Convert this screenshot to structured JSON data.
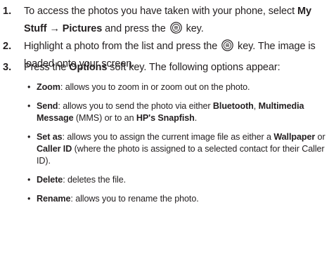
{
  "steps": [
    {
      "num": "1.",
      "t1": "To access the photos you have taken with your phone, select ",
      "b1": "My Stuff",
      "arrow": "→",
      "b2": "Pictures",
      "t2": " and press the ",
      "t3": " key."
    },
    {
      "num": "2.",
      "t1": "Highlight a photo from the list and press the ",
      "t2": " key. The image is loaded onto your screen."
    },
    {
      "num": "3.",
      "t1": "Press the ",
      "b1": "Options",
      "t2": " soft key. The following options appear:"
    }
  ],
  "bullets": [
    {
      "dot": "•",
      "label": "Zoom",
      "text": ": allows you to zoom in or zoom out on the photo."
    },
    {
      "dot": "•",
      "label": "Send",
      "t1": ": allows you to send the photo via either ",
      "b1": "Bluetooth",
      "t2": ", ",
      "b2": "Multimedia Message",
      "t3": " (MMS) or to an ",
      "b3": "HP's Snapfish",
      "t4": "."
    },
    {
      "dot": "•",
      "label": "Set as",
      "t1": ": allows you to assign the current image file as either a ",
      "b1": "Wallpaper",
      "t2": " or ",
      "b2": "Caller ID",
      "t3": " (where the photo is assigned to a selected contact for their Caller ID)."
    },
    {
      "dot": "•",
      "label": "Delete",
      "text": ": deletes the file."
    },
    {
      "dot": "•",
      "label": "Rename",
      "text": ": allows you to rename the photo."
    }
  ],
  "icons": {
    "ok_key": "ok-key-icon"
  }
}
